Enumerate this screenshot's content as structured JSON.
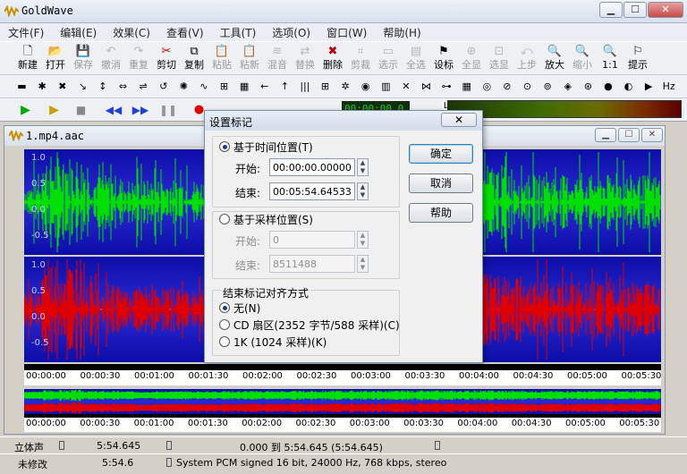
{
  "app": {
    "title": "GoldWave"
  },
  "menu": [
    "文件(F)",
    "编辑(E)",
    "效果(C)",
    "查看(V)",
    "工具(T)",
    "选项(O)",
    "窗口(W)",
    "帮助(H)"
  ],
  "toolbar": [
    {
      "label": "新建",
      "icon": "new-file-icon",
      "enabled": true
    },
    {
      "label": "打开",
      "icon": "open-folder-icon",
      "enabled": true
    },
    {
      "label": "保存",
      "icon": "save-icon",
      "enabled": false
    },
    {
      "label": "撤消",
      "icon": "undo-icon",
      "enabled": false
    },
    {
      "label": "重复",
      "icon": "redo-icon",
      "enabled": false
    },
    {
      "label": "剪切",
      "icon": "scissors-icon",
      "enabled": true
    },
    {
      "label": "复制",
      "icon": "copy-icon",
      "enabled": true
    },
    {
      "label": "粘贴",
      "icon": "paste-icon",
      "enabled": false
    },
    {
      "label": "粘新",
      "icon": "paste-new-icon",
      "enabled": false
    },
    {
      "label": "混音",
      "icon": "mix-icon",
      "enabled": false
    },
    {
      "label": "替换",
      "icon": "replace-icon",
      "enabled": false
    },
    {
      "label": "删除",
      "icon": "delete-icon",
      "enabled": true
    },
    {
      "label": "剪裁",
      "icon": "trim-icon",
      "enabled": false
    },
    {
      "label": "选示",
      "icon": "select-view-icon",
      "enabled": false
    },
    {
      "label": "全选",
      "icon": "select-all-icon",
      "enabled": false
    },
    {
      "label": "设标",
      "icon": "set-marker-icon",
      "enabled": true
    },
    {
      "label": "全显",
      "icon": "show-all-icon",
      "enabled": false
    },
    {
      "label": "选显",
      "icon": "zoom-selection-icon",
      "enabled": false
    },
    {
      "label": "上步",
      "icon": "previous-zoom-icon",
      "enabled": false
    },
    {
      "label": "放大",
      "icon": "zoom-in-icon",
      "enabled": true
    },
    {
      "label": "缩小",
      "icon": "zoom-out-icon",
      "enabled": false
    },
    {
      "label": "1:1",
      "icon": "zoom-1to1-icon",
      "enabled": true
    },
    {
      "label": "提示",
      "icon": "cue-icon",
      "enabled": true
    }
  ],
  "document": {
    "title": "1.mp4.aac",
    "axis_labels": [
      "1.0",
      "0.5",
      "0.0",
      "-0.5"
    ],
    "ruler_ticks": [
      "00:00:00",
      "00:00:30",
      "00:01:00",
      "00:01:30",
      "00:02:00",
      "00:02:30",
      "00:03:00",
      "00:03:30",
      "00:04:00",
      "00:04:30",
      "00:05:00",
      "00:05:30"
    ],
    "overview_ticks": [
      "00:00:00",
      "00:00:30",
      "00:01:00",
      "00:01:30",
      "00:02:00",
      "00:02:30",
      "00:03:00",
      "00:03:30",
      "00:04:00",
      "00:04:30",
      "00:05:00",
      "00:05:30"
    ],
    "colors": {
      "left_channel": "#00e000",
      "right_channel": "#e00000",
      "background": "#1a1ac0"
    }
  },
  "transport": {
    "counter": "00:00:00.0"
  },
  "meter": {
    "label": "L"
  },
  "status": {
    "channels": "立体声",
    "length": "5:54.645",
    "selection": "0.000 到 5:54.645 (5:54.645)",
    "modified": "未修改",
    "position": "5:54.6",
    "format": "System PCM signed 16 bit, 24000 Hz, 768 kbps, stereo"
  },
  "dialog": {
    "title": "设置标记",
    "close": "✕",
    "time_option": "基于时间位置(T)",
    "start_label": "开始:",
    "start_value": "00:00:00.00000",
    "end_label": "结束:",
    "end_value": "00:05:54.64533",
    "sample_option": "基于采样位置(S)",
    "sample_start_label": "开始:",
    "sample_start_value": "0",
    "sample_end_label": "结束:",
    "sample_end_value": "8511488",
    "align_group": "结束标记对齐方式",
    "align_none": "无(N)",
    "align_cd": "CD 扇区(2352 字节/588 采样)(C)",
    "align_1k": "1K (1024 采样)(K)",
    "ok": "确定",
    "cancel": "取消",
    "help": "帮助"
  }
}
